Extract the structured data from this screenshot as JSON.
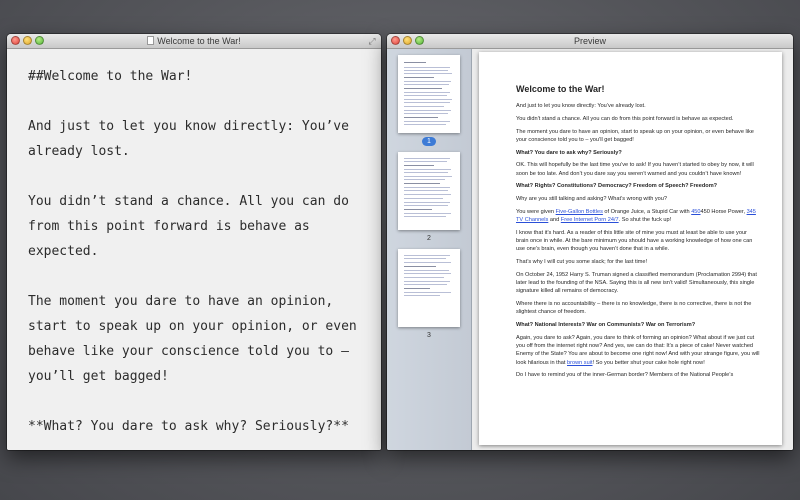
{
  "editor": {
    "title": "Welcome to the War!",
    "lines": [
      "##Welcome to the War!",
      "And just to let you know directly: You’ve already lost.",
      "You didn’t stand a chance. All you can do from this point forward is behave as expected.",
      "The moment you dare to have an opinion, start to speak up on your opinion, or even behave like your conscience told you to — you’ll get bagged!",
      "**What? You dare to ask why? Seriously?**"
    ]
  },
  "preview": {
    "title": "Preview",
    "thumbnails": [
      "1",
      "2",
      "3"
    ],
    "selected_page": "1",
    "page": {
      "heading": "Welcome to the War!",
      "p1": "And just to let you know directly: You’ve already lost.",
      "p2": "You didn’t stand a chance. All you can do from this point forward is behave as expected.",
      "p3": "The moment you dare to have an opinion, start to speak up on your opinion, or even behave like your conscience told you to – you’ll get bagged!",
      "h2": "What? You dare to ask why? Seriously?",
      "p4": "OK. This will hopefully be the last time you’ve to ask! If you haven’t started to obey by now, it will soon be too late. And don’t you dare say you weren’t warned and you couldn’t have known!",
      "h3": "What? Rights? Constitutions? Democracy? Freedom of Speech? Freedom?",
      "p5": "Why are you still talking and asking? What’s wrong with you?",
      "p6_a": "You were given ",
      "p6_link1": "Five-Gallon Bottles",
      "p6_b": " of Orange Juice, a Stupid Car with ",
      "p6_link2": "450",
      "p6_c": "450 Horse Power, ",
      "p6_link3": "345 TV Channels",
      "p6_d": " and ",
      "p6_link4": "Free Internet Porn 24/7",
      "p6_e": ". So shut the fuck up!",
      "p7": "I know that it’s hard. As a reader of this little site of mine you must at least be able to use your brain once in while. At the bare minimum you should have a working knowledge of how one can use one’s brain, even though you haven’t done that in a while.",
      "p8": "That’s why I will cut you some slack; for the last time!",
      "p9": "On October 24, 1952 Harry S. Truman signed a classified memorandum (Proclamation 2994) that later lead to the founding of the NSA. Saying this is all new isn’t valid! Simultaneously, this single signature killed all remains of democracy.",
      "p10": "Where there is no accountability – there is no knowledge, there is no corrective, there is not the slightest chance of freedom.",
      "h4": "What? National Interests? War on Communists? War on Terrorism?",
      "p11_a": "Again, you dare to ask? Again, you dare to think of forming an opinion? What about if we just cut you off from the internet right now? And yes, we can do that: It’s a piece of cake! Never watched Enemy of the State? You are about to become one right now! And with your strange figure, you will look hilarious in that ",
      "p11_link": "brown suit",
      "p11_b": "! So you better shut your cake hole right now!",
      "p12": "Do I have to remind you of the inner-German border? Members of the National People’s"
    }
  }
}
